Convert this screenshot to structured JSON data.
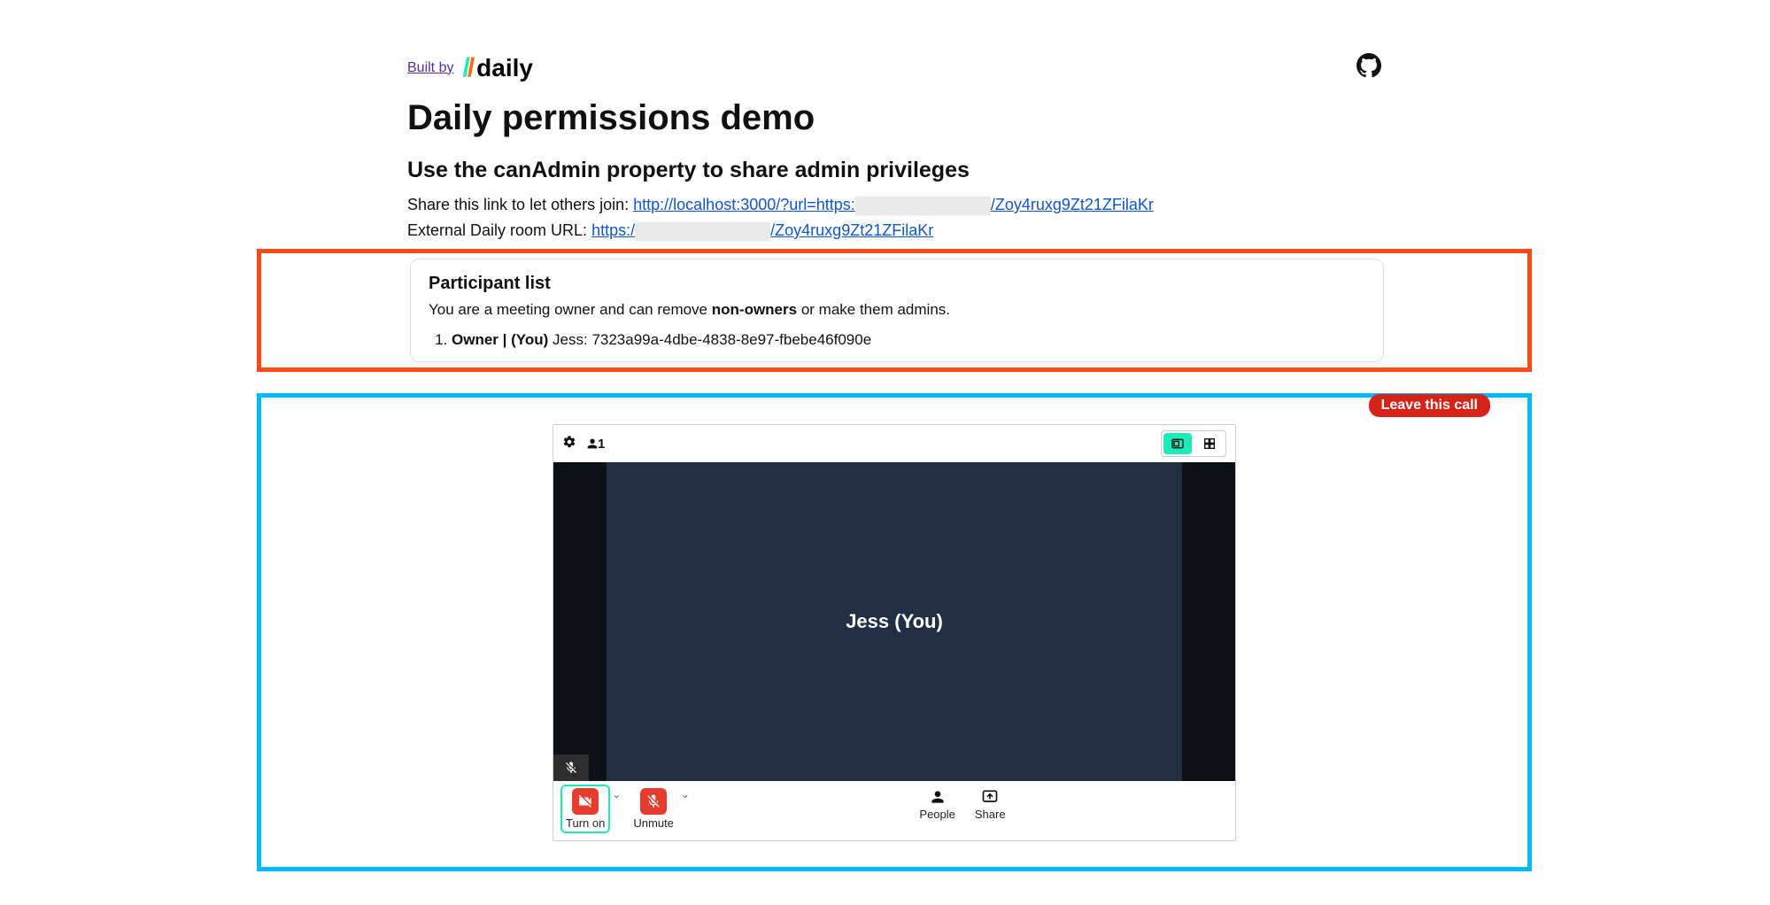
{
  "header": {
    "built_by": "Built by",
    "logo_text": "daily",
    "title": "Daily permissions demo",
    "subtitle": "Use the canAdmin property to share admin privileges"
  },
  "links": {
    "share_label": "Share this link to let others join: ",
    "share_link_pre": "http://localhost:3000/?url=https:",
    "share_link_redact": "████████████",
    "share_link_post": "/Zoy4ruxg9Zt21ZFilaKr",
    "ext_label": "External Daily room URL: ",
    "ext_link_pre": "https:/",
    "ext_link_redact": "████████████",
    "ext_link_post": "/Zoy4ruxg9Zt21ZFilaKr"
  },
  "participants": {
    "heading": "Participant list",
    "sub_pre": "You are a meeting owner and can remove ",
    "sub_bold": "non-owners",
    "sub_post": " or make them admins.",
    "items": [
      {
        "role": "Owner | (You)",
        "name": "Jess",
        "id": "7323a99a-4dbe-4838-8e97-fbebe46f090e"
      }
    ]
  },
  "call": {
    "leave_label": "Leave this call",
    "count": "1",
    "video_label": "Jess (You)",
    "controls": {
      "turn_on": "Turn on",
      "unmute": "Unmute",
      "people": "People",
      "share": "Share"
    }
  }
}
